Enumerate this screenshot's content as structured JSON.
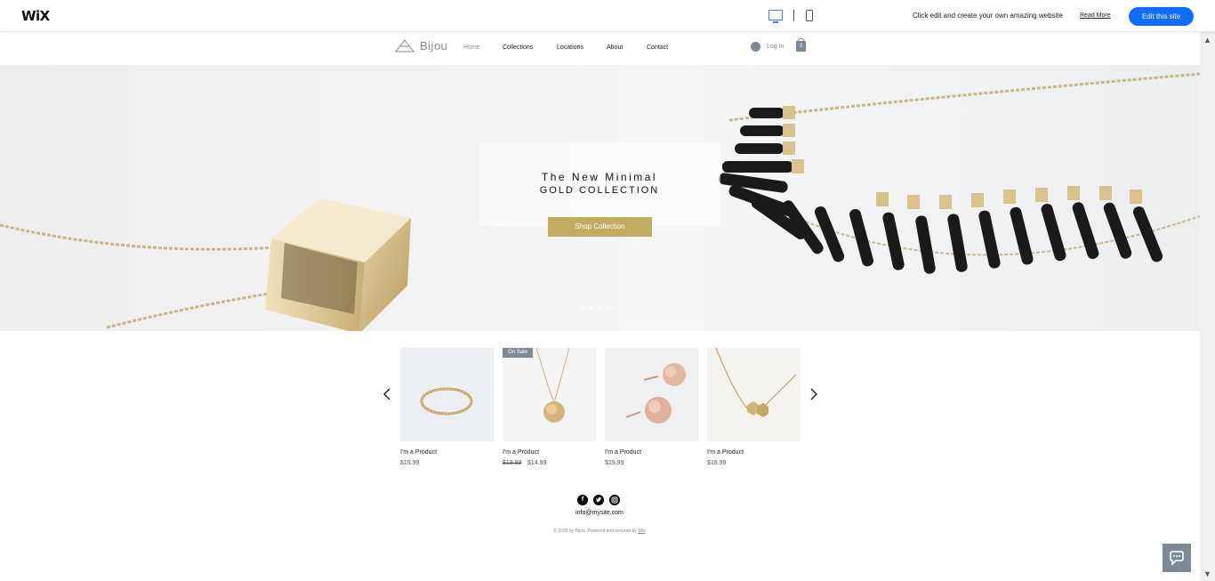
{
  "wix_bar": {
    "logo": "WiX",
    "message": "Click edit and create your own amazing website",
    "read_more": "Read More",
    "edit_button": "Edit this site",
    "icons": [
      "desktop-icon",
      "mobile-icon"
    ],
    "accent_color": "#116dff"
  },
  "site": {
    "brand": "Bijou",
    "nav": [
      "Home",
      "Collections",
      "Locations",
      "About",
      "Contact"
    ],
    "active_nav": "Home",
    "login": "Log In",
    "cart_count": "0"
  },
  "hero": {
    "title_line1": "The New Minimal",
    "title_line2": "GOLD COLLECTION",
    "button": "Shop Collection",
    "button_color": "#c2ac61",
    "slide_count": 3
  },
  "products": [
    {
      "name": "I'm a Product",
      "price": "$19.99",
      "old_price": null,
      "badge": null
    },
    {
      "name": "I'm a Product",
      "price": "$14.99",
      "old_price": "$19.99",
      "badge": "On Sale"
    },
    {
      "name": "I'm a Product",
      "price": "$19.99",
      "old_price": null,
      "badge": null
    },
    {
      "name": "I'm a Product",
      "price": "$19.99",
      "old_price": null,
      "badge": null
    }
  ],
  "footer": {
    "social": [
      "facebook-icon",
      "twitter-icon",
      "instagram-icon"
    ],
    "email": "info@mysite.com",
    "copyright": "© 2035 by Bijou. Powered and secured by",
    "copyright_link": "Wix"
  }
}
